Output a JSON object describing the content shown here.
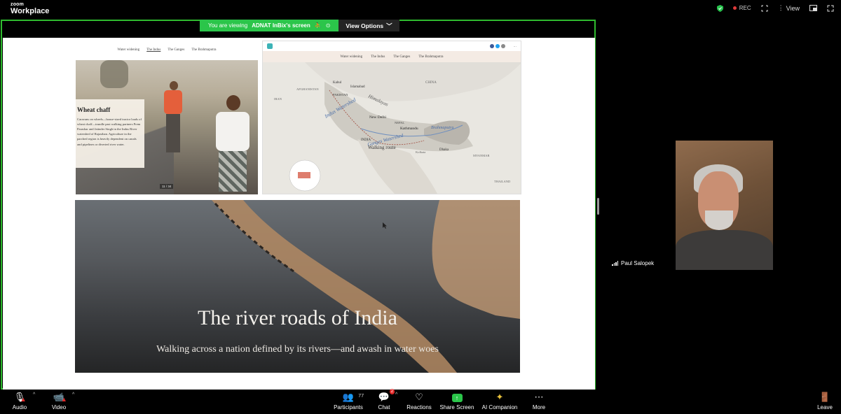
{
  "app": {
    "brand_small": "zoom",
    "brand_large": "Workplace"
  },
  "topbar": {
    "rec_label": "REC",
    "view_label": "View"
  },
  "share_banner": {
    "prefix": "You are viewing",
    "presenter": "ADNAT InBix's screen",
    "view_options": "View Options"
  },
  "article_left": {
    "nav": [
      "Water widening",
      "The Indus",
      "The Ganges",
      "The Brahmaputra"
    ],
    "caption_title": "Wheat chaff",
    "caption_body": "Caravans on wheels—house-sized tractor loads of wheat chaff—trundle past walking partners Prem Parashar and Jatinder Singh in the Indus River watershed of Rajasthan. Agriculture in the parched region is heavily dependent on canals and pipelines or diverted river water.",
    "pager": "11 / 34"
  },
  "article_right": {
    "nav": [
      "Water widening",
      "The Indus",
      "The Ganges",
      "The Brahmaputra"
    ],
    "map_labels": {
      "afghanistan": "AFGHANISTAN",
      "kabul": "Kabul",
      "islamabad": "Islamabad",
      "pakistan": "PAKISTAN",
      "iran": "IRAN",
      "china": "CHINA",
      "himalayas": "Himalayas",
      "indus": "Indus Watershed",
      "ganges": "Ganges Watershed",
      "brahmaputra": "Brahmaputra",
      "new_delhi": "New Delhi",
      "nepal": "NEPAL",
      "kathmandu": "Kathmandu",
      "india": "INDIA",
      "walking_route": "Walking route",
      "dhaka": "Dhaka",
      "kolkata": "Kolkata",
      "myanmar": "MYANMAR",
      "thailand": "THAILAND"
    }
  },
  "hero": {
    "title": "The river roads of India",
    "subtitle": "Walking across a nation defined by its rivers—and awash in water woes"
  },
  "participant": {
    "name": "Paul Salopek"
  },
  "toolbar": {
    "audio": "Audio",
    "video": "Video",
    "participants": "Participants",
    "participants_count": "77",
    "chat": "Chat",
    "chat_badge": "2",
    "reactions": "Reactions",
    "share_screen": "Share Screen",
    "ai_companion": "AI Companion",
    "more": "More",
    "leave": "Leave"
  },
  "colors": {
    "share_border": "#2fbb2f",
    "banner_green": "#2bc54a",
    "leave_red": "#e02828"
  }
}
